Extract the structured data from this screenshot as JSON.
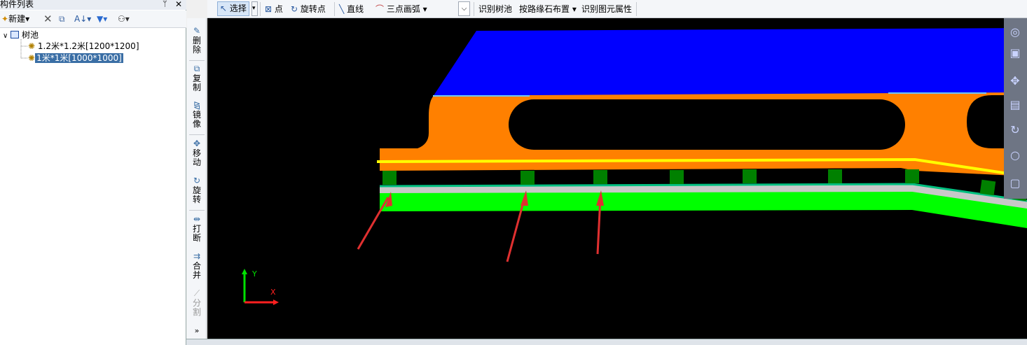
{
  "left_panel": {
    "title": "构件列表",
    "pin_icon": "pin-icon",
    "close_icon": "close-icon",
    "toolbar": {
      "new_label": "新建",
      "delete_icon": "delete-icon",
      "copy_icon": "copy-icon",
      "sort_icon": "sort-icon",
      "filter_icon": "filter-icon",
      "find_icon": "binoculars-icon"
    },
    "tree": {
      "root": "树池",
      "children": [
        {
          "label": "1.2米*1.2米[1200*1200]",
          "selected": false
        },
        {
          "label": "1米*1米[1000*1000]",
          "selected": true
        }
      ]
    }
  },
  "vertical_toolbar": [
    {
      "label_top": "删",
      "label_bottom": "除",
      "icon": "eraser-icon",
      "enabled": true
    },
    {
      "label_top": "复",
      "label_bottom": "制",
      "icon": "copy-icon",
      "enabled": true
    },
    {
      "label_top": "镜",
      "label_bottom": "像",
      "icon": "mirror-icon",
      "enabled": true
    },
    {
      "label_top": "移",
      "label_bottom": "动",
      "icon": "move-icon",
      "enabled": true
    },
    {
      "label_top": "旋",
      "label_bottom": "转",
      "icon": "rotate-icon",
      "enabled": true
    },
    {
      "label_top": "打",
      "label_bottom": "断",
      "icon": "break-icon",
      "enabled": true
    },
    {
      "label_top": "合",
      "label_bottom": "并",
      "icon": "merge-icon",
      "enabled": true
    },
    {
      "label_top": "分",
      "label_bottom": "割",
      "icon": "split-icon",
      "enabled": false
    }
  ],
  "top_toolbar": {
    "select": "选择",
    "point": "点",
    "rotate_point": "旋转点",
    "line": "直线",
    "arc": "三点画弧",
    "identify_tree_pool": "识别树池",
    "layout_by_curb": "按路缘石布置",
    "identify_properties": "识别图元属性"
  },
  "canvas": {
    "axis_y": "Y",
    "axis_x": "X"
  },
  "colors": {
    "roof": "#0000ff",
    "body": "#ff8000",
    "stripe": "#ffff00",
    "tree_pool": "#008000",
    "base": "#00ff00",
    "arrow": "#e03030"
  }
}
